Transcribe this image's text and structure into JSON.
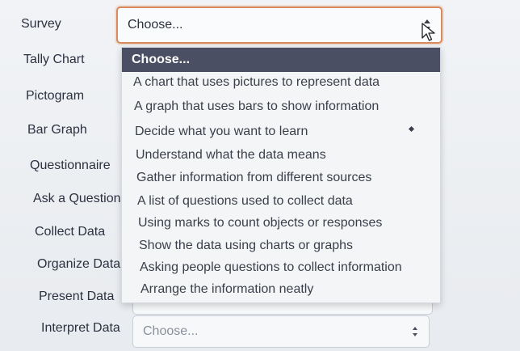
{
  "terms": [
    "Survey",
    "Tally Chart",
    "Pictogram",
    "Bar Graph",
    "Questionnaire",
    "Ask a Question",
    "Collect Data",
    "Organize Data",
    "Present Data",
    "Interpret Data"
  ],
  "active_select": {
    "value": "Choose..."
  },
  "bottom_select": {
    "value": "Choose..."
  },
  "dropdown": {
    "options": [
      "Choose...",
      "A chart that uses pictures to represent data",
      "A graph that uses bars to show information",
      "Decide what you want to learn",
      "Understand what the data means",
      "Gather information from different sources",
      "A list of questions used to collect data",
      "Using marks to count objects or responses",
      "Show the data using charts or graphs",
      "Asking people questions to collect information",
      "Arrange the information neatly"
    ],
    "selected_index": 0
  },
  "colors": {
    "focus_border": "#d9895b",
    "selected_bg": "#4a4f63",
    "dropdown_bg": "#f4f5f7"
  },
  "icons": [
    "sort-arrows-icon",
    "mouse-cursor-icon"
  ]
}
